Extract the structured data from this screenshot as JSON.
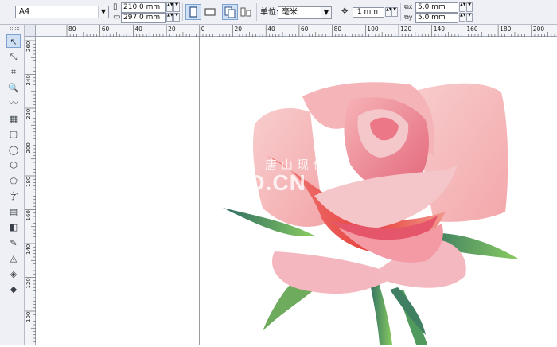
{
  "property_bar": {
    "paper_preset": "A4",
    "page_width": "210.0 mm",
    "page_height": "297.0 mm",
    "unit_label": "单位:",
    "unit_value": "毫米",
    "nudge_value": ".1 mm",
    "duplicate_x": "5.0 mm",
    "duplicate_y": "5.0 mm"
  },
  "rulers": {
    "horizontal_ticks": [
      "80",
      "60",
      "40",
      "20",
      "0",
      "20",
      "40",
      "60",
      "80",
      "100",
      "120",
      "140",
      "160",
      "180",
      "200"
    ],
    "vertical_ticks": [
      "260",
      "240",
      "220",
      "200",
      "180",
      "160",
      "140",
      "120",
      "100"
    ]
  },
  "toolbox": {
    "tools": [
      "pick-tool",
      "shape-tool",
      "crop-tool",
      "zoom-tool",
      "freehand-tool",
      "smart-fill-tool",
      "rectangle-tool",
      "ellipse-tool",
      "polygon-tool",
      "basic-shapes-tool",
      "text-tool",
      "table-tool",
      "interactive-effects-tool",
      "eyedropper-tool",
      "outline-tool",
      "fill-tool",
      "interactive-fill-tool"
    ],
    "glyphs": [
      "↖",
      "⤡",
      "⌗",
      "🔍",
      "〰",
      "▦",
      "▢",
      "◯",
      "⬡",
      "⬠",
      "字",
      "▤",
      "◧",
      "✎",
      "◬",
      "◈",
      "◆"
    ]
  },
  "watermark": {
    "text_cn": "唐山现代",
    "text_en": "SXD.CN"
  },
  "colors": {
    "petal_light": "#f6c3c3",
    "petal_mid": "#f08e92",
    "petal_deep": "#e23b3b",
    "leaf_green": "#7cc05a",
    "leaf_dark": "#2e6e63"
  }
}
